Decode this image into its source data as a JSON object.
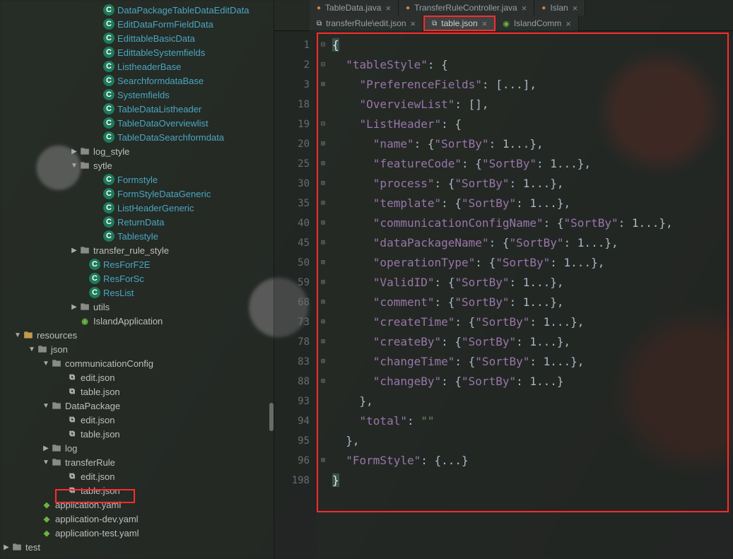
{
  "tree": {
    "classes": [
      "DataPackageTableDataEditData",
      "EditDataFormFieldData",
      "EdittableBasicData",
      "EdittableSystemfields",
      "ListheaderBase",
      "SearchformdataBase",
      "Systemfields",
      "TableDataListheader",
      "TableDataOverviewlist",
      "TableDataSearchformdata"
    ],
    "log_style": "log_style",
    "sytle": {
      "label": "sytle",
      "children": [
        "Formstyle",
        "FormStyleDataGeneric",
        "ListHeaderGeneric",
        "ReturnData",
        "Tablestyle"
      ]
    },
    "transfer_rule_style": "transfer_rule_style",
    "root_classes": [
      "ResForF2E",
      "ResForSc",
      "ResList"
    ],
    "utils": "utils",
    "island_app": "IslandApplication",
    "resources": "resources",
    "json": "json",
    "comm_cfg": {
      "label": "communicationConfig",
      "children": [
        "edit.json",
        "table.json"
      ]
    },
    "data_pkg": {
      "label": "DataPackage",
      "children": [
        "edit.json",
        "table.json"
      ]
    },
    "log": "log",
    "transferRule": {
      "label": "transferRule",
      "children": [
        "edit.json",
        "table.json"
      ]
    },
    "yaml": [
      "application.yaml",
      "application-dev.yaml",
      "application-test.yaml"
    ],
    "test": "test"
  },
  "tabs_row1": [
    {
      "label": "TableData.java",
      "kind": "java"
    },
    {
      "label": "TransferRuleController.java",
      "kind": "java"
    },
    {
      "label": "Islan",
      "kind": "java"
    }
  ],
  "tabs_row2": [
    {
      "label": "transferRule\\edit.json",
      "kind": "json"
    },
    {
      "label": "table.json",
      "kind": "json",
      "active": true,
      "highlight": true
    },
    {
      "label": "IslandComm",
      "kind": "spring"
    }
  ],
  "gutter": [
    "1",
    "2",
    "3",
    "18",
    "19",
    "20",
    "25",
    "30",
    "35",
    "40",
    "45",
    "50",
    "59",
    "68",
    "73",
    "78",
    "83",
    "88",
    "93",
    "94",
    "95",
    "96",
    "198"
  ],
  "code": {
    "l1": "{",
    "l2_key": "\"tableStyle\"",
    "l2_rest": ": {",
    "l3_key": "\"PreferenceFields\"",
    "l3_rest": ": [...],",
    "l4_key": "\"OverviewList\"",
    "l4_rest": ": [],",
    "l5_key": "\"ListHeader\"",
    "l5_rest": ": {",
    "lh": [
      {
        "k": "\"name\"",
        "v": "{\"SortBy\": 1...},"
      },
      {
        "k": "\"featureCode\"",
        "v": "{\"SortBy\": 1...},"
      },
      {
        "k": "\"process\"",
        "v": "{\"SortBy\": 1...},"
      },
      {
        "k": "\"template\"",
        "v": "{\"SortBy\": 1...},"
      },
      {
        "k": "\"communicationConfigName\"",
        "v": "{\"SortBy\": 1...},"
      },
      {
        "k": "\"dataPackageName\"",
        "v": "{\"SortBy\": 1...},"
      },
      {
        "k": "\"operationType\"",
        "v": "{\"SortBy\": 1...},"
      },
      {
        "k": "\"ValidID\"",
        "v": "{\"SortBy\": 1...},"
      },
      {
        "k": "\"comment\"",
        "v": "{\"SortBy\": 1...},"
      },
      {
        "k": "\"createTime\"",
        "v": "{\"SortBy\": 1...},"
      },
      {
        "k": "\"createBy\"",
        "v": "{\"SortBy\": 1...},"
      },
      {
        "k": "\"changeTime\"",
        "v": "{\"SortBy\": 1...},"
      },
      {
        "k": "\"changeBy\"",
        "v": "{\"SortBy\": 1...}"
      }
    ],
    "l_close_lh": "},",
    "l_total_key": "\"total\"",
    "l_total_val": "\"\"",
    "l_close_ts": "},",
    "l_fs_key": "\"FormStyle\"",
    "l_fs_rest": ": {...}",
    "l_end": "}"
  }
}
